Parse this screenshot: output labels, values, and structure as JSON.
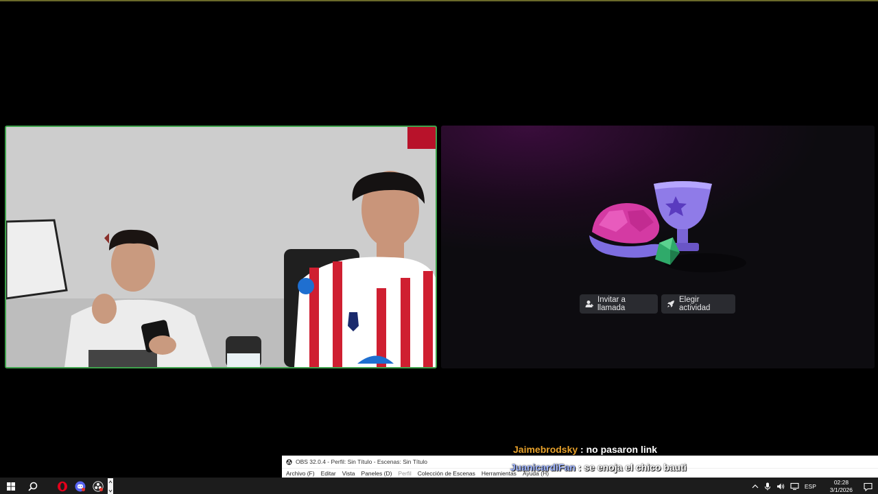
{
  "activity_panel": {
    "invite_label": "Invitar a llamada",
    "choose_activity_label": "Elegir actividad"
  },
  "chat": [
    {
      "user": "Jaimebrodsky",
      "separator": " : ",
      "message": "no pasaron link"
    },
    {
      "user": "JuanicardiFan",
      "separator": " : ",
      "message": "se enoja el chico bauti"
    }
  ],
  "obs": {
    "title": "OBS 32.0.4 - Perfil: Sin Título - Escenas: Sin Título",
    "menu": [
      "Archivo (F)",
      "Editar",
      "Vista",
      "Paneles (D)",
      "Perfil",
      "Colección de Escenas",
      "Herramientas",
      "Ayuda (H)"
    ]
  },
  "taskbar": {
    "language": "ESP",
    "time": "02:28",
    "date": "3/1/2026"
  },
  "colors": {
    "webcam_border": "#3fa34d",
    "chat_user_1": "#e7a12a",
    "chat_user_2": "#9eb4ff",
    "taskbar_bg": "#1c1c1c"
  }
}
